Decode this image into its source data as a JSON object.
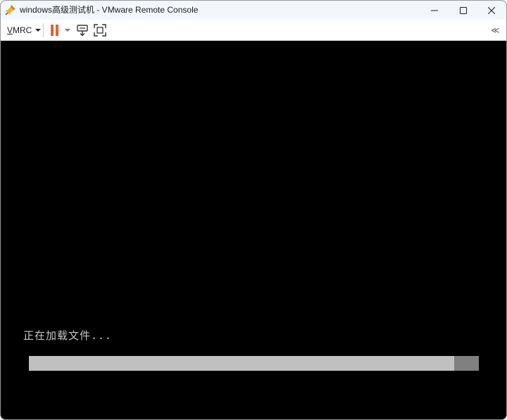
{
  "window": {
    "title": "windows高级测试机 - VMware Remote Console",
    "app_icon": "vmware-pin-icon",
    "controls": [
      "minimize-icon",
      "maximize-icon",
      "close-icon"
    ]
  },
  "toolbar": {
    "menu_label": "VMRC",
    "pause_icon": "pause-icon",
    "send_keys_icon": "send-ctrl-alt-del-icon",
    "fullscreen_icon": "fullscreen-icon",
    "collapse_label": "≪"
  },
  "console": {
    "status_text": "正在加载文件...",
    "progress": 0.945
  },
  "colors": {
    "titlebar": "#f3f6fb",
    "console_bg": "#000000",
    "pause_accent": "#e8622a",
    "progress_fill": "#c0c0c0",
    "progress_track": "#808080"
  }
}
